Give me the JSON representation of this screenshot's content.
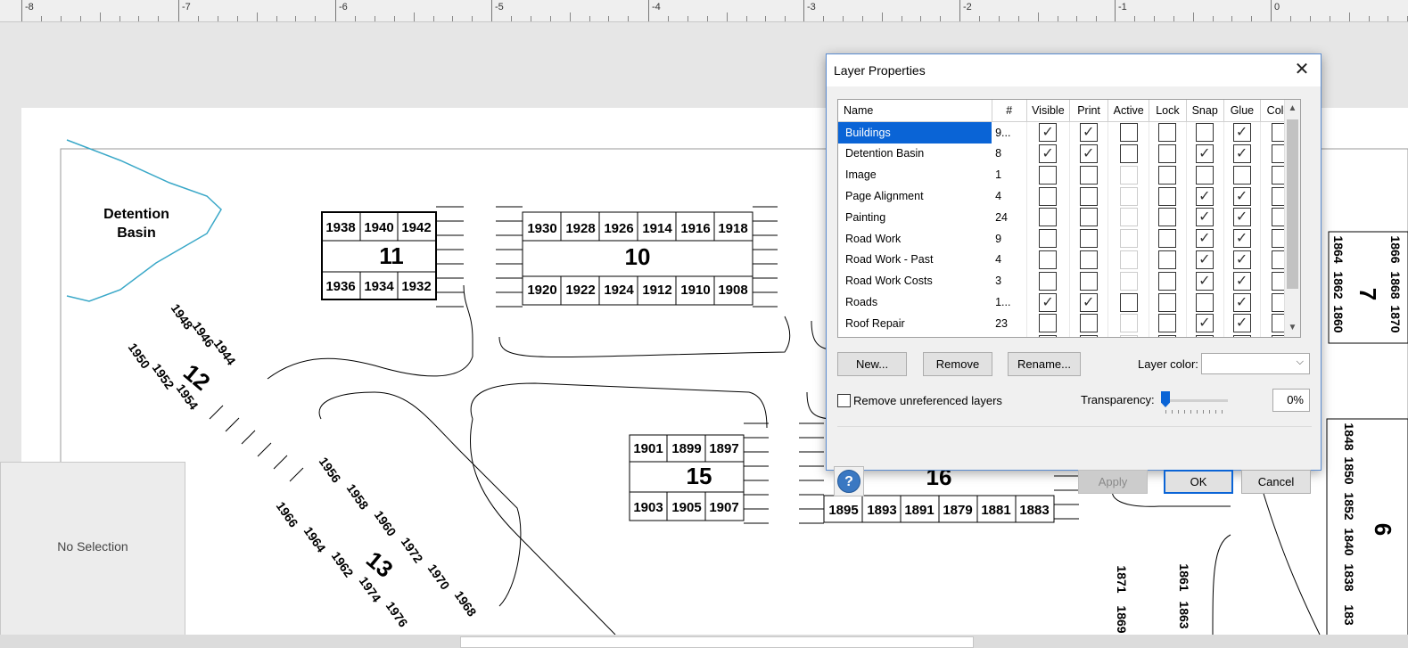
{
  "ruler": {
    "marks": [
      "-8",
      "-7",
      "-6",
      "-5",
      "-4",
      "-3",
      "-2",
      "-1",
      "0"
    ]
  },
  "panel": {
    "message": "No Selection"
  },
  "drawing": {
    "detention_label_1": "Detention",
    "detention_label_2": "Basin",
    "b11": {
      "label": "11",
      "top": [
        "1938",
        "1940",
        "1942"
      ],
      "bottom": [
        "1936",
        "1934",
        "1932"
      ]
    },
    "b10": {
      "label": "10",
      "top": [
        "1930",
        "1928",
        "1926",
        "1914",
        "1916",
        "1918"
      ],
      "bottom": [
        "1920",
        "1922",
        "1924",
        "1912",
        "1910",
        "1908"
      ]
    },
    "b12": {
      "label": "12",
      "units": [
        "1948",
        "1946",
        "1944",
        "1950",
        "1952",
        "1954"
      ]
    },
    "b13": {
      "label": "13",
      "units": [
        "1956",
        "1958",
        "1960",
        "1972",
        "1970",
        "1968",
        "1966",
        "1964",
        "1962",
        "1974",
        "1976"
      ]
    },
    "b15": {
      "label": "15",
      "top": [
        "1901",
        "1899",
        "1897"
      ],
      "bottom": [
        "1903",
        "1905",
        "1907"
      ]
    },
    "b16": {
      "label": "16",
      "bottom": [
        "1895",
        "1893",
        "1891",
        "1879",
        "1881",
        "1883"
      ]
    },
    "b7": {
      "label": "7",
      "units": [
        "1864",
        "1862",
        "1860",
        "1866",
        "1868",
        "1870"
      ]
    },
    "b6": {
      "label": "6",
      "units": [
        "1848",
        "1850",
        "1852",
        "1840",
        "1838",
        "183"
      ]
    },
    "misc": [
      "1871",
      "1869",
      "1861",
      "1863"
    ]
  },
  "dialog": {
    "title": "Layer Properties",
    "close": "✕",
    "columns": [
      "Name",
      "#",
      "Visible",
      "Print",
      "Active",
      "Lock",
      "Snap",
      "Glue",
      "Color"
    ],
    "layers": [
      {
        "name": "Buildings",
        "count": "9...",
        "visible": true,
        "print": true,
        "active": "box",
        "lock": false,
        "snap": false,
        "glue": true,
        "color": false,
        "selected": true
      },
      {
        "name": "Detention Basin",
        "count": "8",
        "visible": true,
        "print": true,
        "active": "box",
        "lock": false,
        "snap": true,
        "glue": true,
        "color": false
      },
      {
        "name": "Image",
        "count": "1",
        "visible": false,
        "print": false,
        "active": "dim",
        "lock": false,
        "snap": false,
        "glue": false,
        "color": false
      },
      {
        "name": "Page Alignment",
        "count": "4",
        "visible": false,
        "print": false,
        "active": "dim",
        "lock": false,
        "snap": true,
        "glue": true,
        "color": false
      },
      {
        "name": "Painting",
        "count": "24",
        "visible": false,
        "print": false,
        "active": "dim",
        "lock": false,
        "snap": true,
        "glue": true,
        "color": false
      },
      {
        "name": "Road Work",
        "count": "9",
        "visible": false,
        "print": false,
        "active": "dim",
        "lock": false,
        "snap": true,
        "glue": true,
        "color": false
      },
      {
        "name": "Road Work - Past",
        "count": "4",
        "visible": false,
        "print": false,
        "active": "dim",
        "lock": false,
        "snap": true,
        "glue": true,
        "color": false
      },
      {
        "name": "Road Work Costs",
        "count": "3",
        "visible": false,
        "print": false,
        "active": "dim",
        "lock": false,
        "snap": true,
        "glue": true,
        "color": false
      },
      {
        "name": "Roads",
        "count": "1...",
        "visible": true,
        "print": true,
        "active": "box",
        "lock": false,
        "snap": false,
        "glue": true,
        "color": false
      },
      {
        "name": "Roof Repair",
        "count": "23",
        "visible": false,
        "print": false,
        "active": "dim",
        "lock": false,
        "snap": true,
        "glue": true,
        "color": false
      },
      {
        "name": "",
        "count": "",
        "visible": false,
        "print": false,
        "active": "dim",
        "lock": false,
        "snap": false,
        "glue": false,
        "color": false
      }
    ],
    "buttons": {
      "new": "New...",
      "remove": "Remove",
      "rename": "Rename...",
      "apply": "Apply",
      "ok": "OK",
      "cancel": "Cancel"
    },
    "layer_color_label": "Layer color:",
    "layer_color_value": "",
    "remove_unreferenced": "Remove unreferenced layers",
    "transparency_label": "Transparency:",
    "transparency_value": "0%",
    "transparency_level": 0,
    "help": "?"
  }
}
